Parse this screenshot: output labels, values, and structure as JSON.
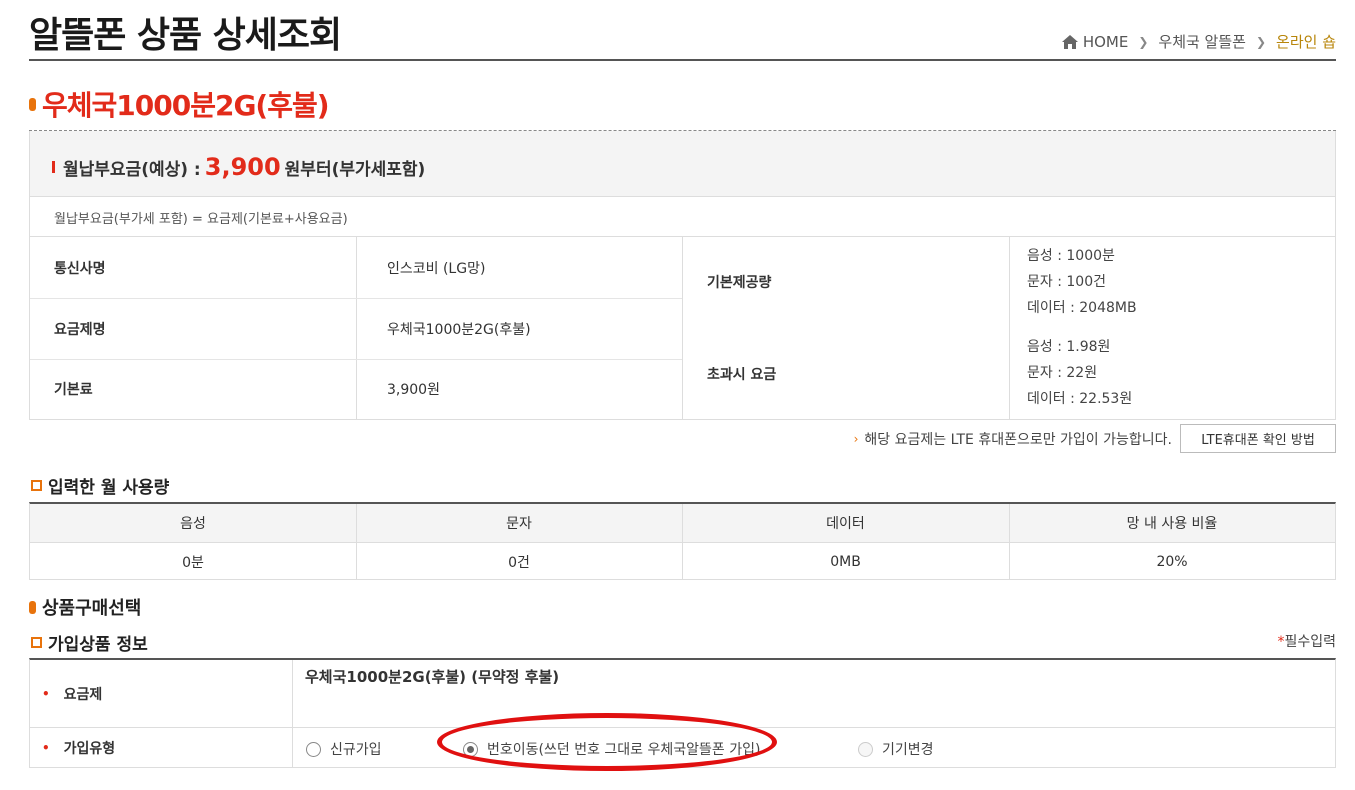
{
  "header": {
    "title": "알뜰폰 상품 상세조회",
    "breadcrumb": [
      "HOME",
      "우체국 알뜰폰",
      "온라인 숍"
    ]
  },
  "product": {
    "title": "우체국1000분2G(후불)"
  },
  "fee": {
    "label": "월납부요금(예상) :",
    "price": "3,900",
    "suffix": "원부터(부가세포함)",
    "formula": "월납부요금(부가세 포함) = 요금제(기본료+사용요금)"
  },
  "info": {
    "carrier_label": "통신사명",
    "carrier_value": "인스코비 (LG망)",
    "plan_label": "요금제명",
    "plan_value": "우체국1000분2G(후불)",
    "base_fee_label": "기본료",
    "base_fee_value": "3,900원",
    "provided_label": "기본제공량",
    "provided_voice": "음성 : 1000분",
    "provided_sms": "문자 : 100건",
    "provided_data": "데이터 : 2048MB",
    "overage_label": "초과시 요금",
    "overage_voice": "음성 : 1.98원",
    "overage_sms": "문자 : 22원",
    "overage_data": "데이터 : 22.53원"
  },
  "lte": {
    "notice": "해당 요금제는 LTE 휴대폰으로만 가입이 가능합니다.",
    "button": "LTE휴대폰 확인 방법"
  },
  "usage": {
    "heading": "입력한 월 사용량",
    "headers": [
      "음성",
      "문자",
      "데이터",
      "망 내 사용 비율"
    ],
    "values": [
      "0분",
      "0건",
      "0MB",
      "20%"
    ]
  },
  "purchase": {
    "heading": "상품구매선택",
    "sub_heading": "가입상품 정보",
    "required_note": "필수입력",
    "plan_label": "요금제",
    "plan_value": "우체국1000분2G(후불) (무약정 후불)",
    "type_label": "가입유형",
    "options": [
      "신규가입",
      "번호이동(쓰던 번호 그대로 우체국알뜰폰 가입)",
      "기기변경"
    ],
    "selected": "번호이동(쓰던 번호 그대로 우체국알뜰폰 가입)"
  },
  "colors": {
    "accent_red": "#e22b1a",
    "accent_orange": "#e8730c",
    "highlight": "#e01010"
  }
}
